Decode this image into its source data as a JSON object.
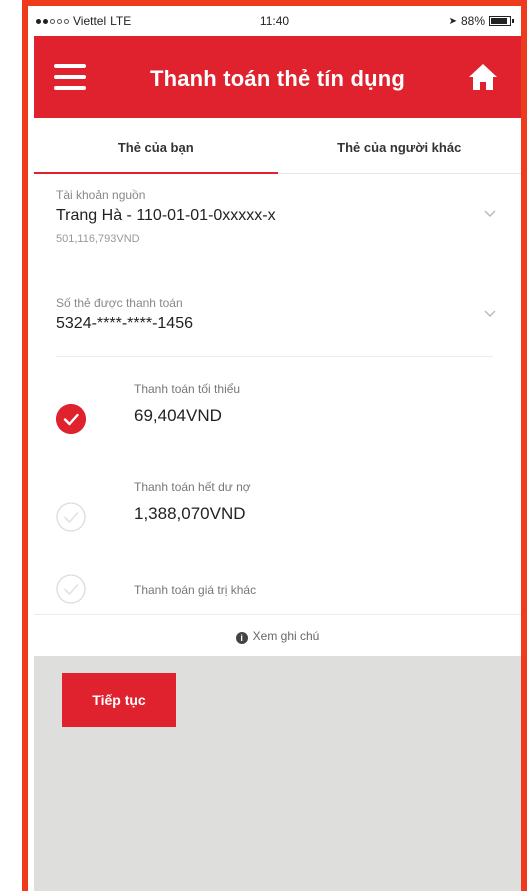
{
  "status_bar": {
    "carrier": "Viettel",
    "network": "LTE",
    "time": "11:40",
    "battery": "88%",
    "battery_level": 0.88
  },
  "header": {
    "title": "Thanh toán thẻ tín dụng",
    "menu_icon": "menu-icon",
    "home_icon": "home-icon"
  },
  "tabs": [
    {
      "label": "Thẻ của bạn",
      "active": true
    },
    {
      "label": "Thẻ của người khác",
      "active": false
    }
  ],
  "source_account": {
    "label": "Tài khoản nguồn",
    "value": "Trang Hà - 110-01-01-0xxxxx-x",
    "balance": "501,116,793VND"
  },
  "card": {
    "label": "Số thẻ được thanh toán",
    "value": "5324-****-****-1456"
  },
  "options": [
    {
      "label": "Thanh toán tối thiểu",
      "value": "69,404VND",
      "selected": true
    },
    {
      "label": "Thanh toán hết dư nợ",
      "value": "1,388,070VND",
      "selected": false
    },
    {
      "label": "Thanh toán giá trị khác",
      "value": "",
      "selected": false
    }
  ],
  "note": {
    "label": "Xem ghi chú"
  },
  "actions": {
    "continue_label": "Tiếp tục"
  },
  "colors": {
    "brand": "#e0222e",
    "frame": "#ee3a1d",
    "footer_bg": "#dededc"
  }
}
